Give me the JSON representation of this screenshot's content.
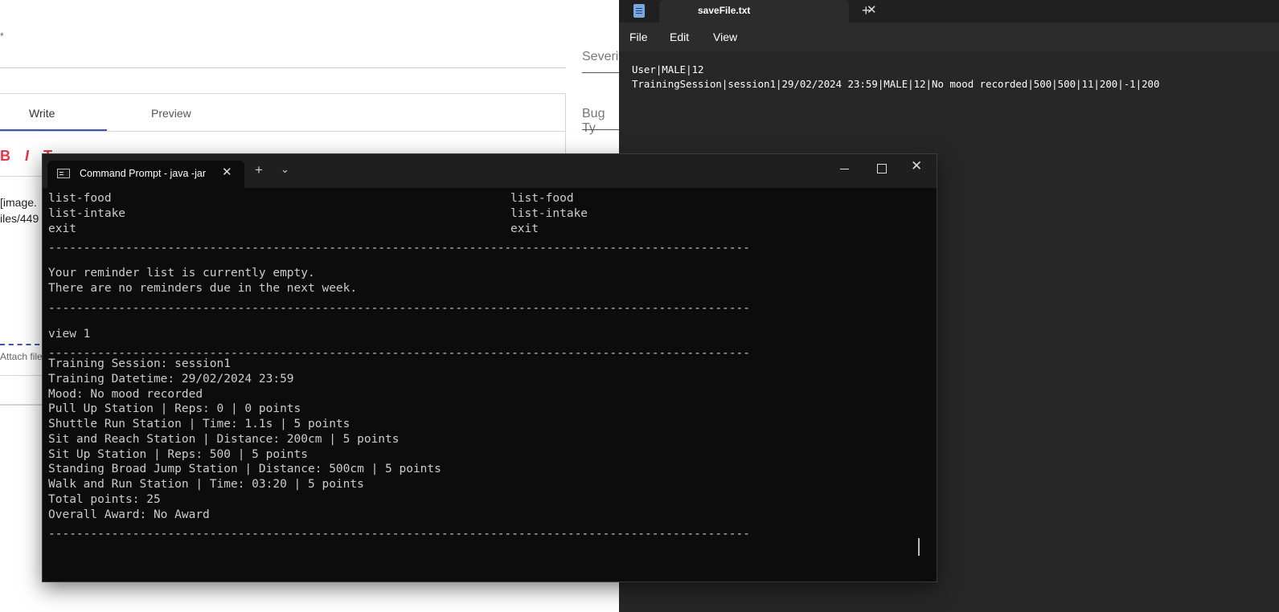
{
  "web_form": {
    "asterisk": "*",
    "severity_label": "Severit",
    "bugtype_label": "Bug Ty",
    "tabs": [
      "Write",
      "Preview"
    ],
    "toolbar_glyphs": "BIT",
    "editor_lines": [
      "[image.",
      "iles/449"
    ],
    "attach_label": "Attach file"
  },
  "notepad": {
    "tab_title": "saveFile.txt",
    "menu": [
      "File",
      "Edit",
      "View"
    ],
    "lines": [
      "User|MALE|12",
      "TrainingSession|session1|29/02/2024 23:59|MALE|12|No mood recorded|500|500|11|200|-1|200"
    ]
  },
  "cmd": {
    "tab_title": "Command Prompt - java  -jar",
    "col1": [
      "list-food",
      "list-intake",
      "exit"
    ],
    "col2": [
      "list-food",
      "list-intake",
      "exit"
    ],
    "separator": "----------------------------------------------------------------------------------------------------",
    "reminder_lines": [
      "Your reminder list is currently empty.",
      "There are no reminders due in the next week."
    ],
    "command": "view 1",
    "session_lines": [
      "Training Session: session1",
      "Training Datetime: 29/02/2024 23:59",
      "Mood: No mood recorded",
      "Pull Up Station | Reps: 0 | 0 points",
      "Shuttle Run Station | Time: 1.1s | 5 points",
      "Sit and Reach Station | Distance: 200cm | 5 points",
      "Sit Up Station | Reps: 500 | 5 points",
      "Standing Broad Jump Station | Distance: 500cm | 5 points",
      "Walk and Run Station | Time: 03:20 | 5 points",
      "Total points: 25",
      "Overall Award: No Award"
    ]
  }
}
